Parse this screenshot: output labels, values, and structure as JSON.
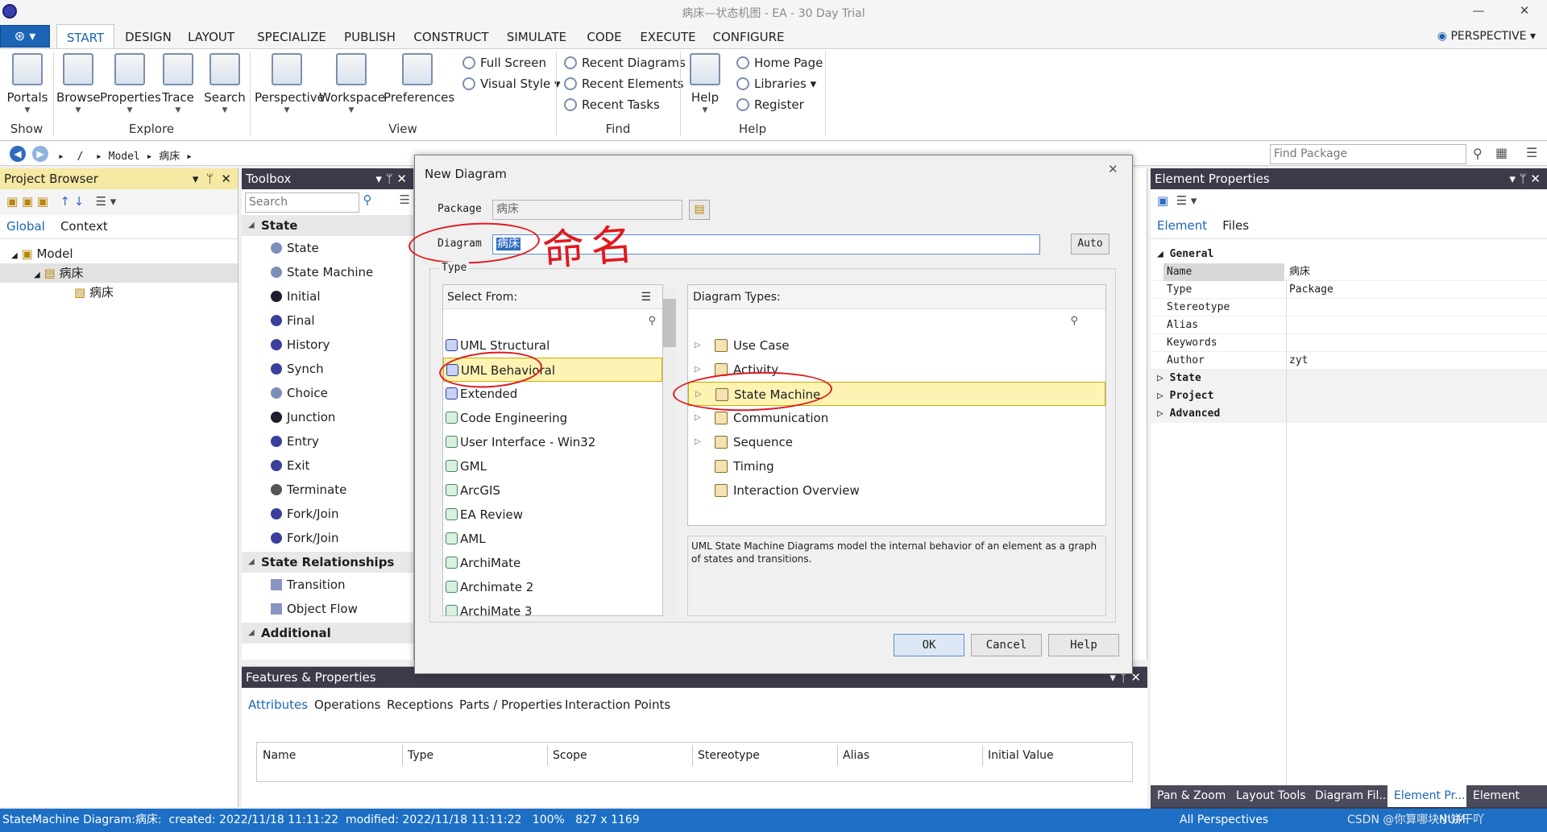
{
  "window": {
    "title": "病床—状态机图 - EA - 30 Day Trial"
  },
  "menu": {
    "tabs": [
      "START",
      "DESIGN",
      "LAYOUT",
      "SPECIALIZE",
      "PUBLISH",
      "CONSTRUCT",
      "SIMULATE",
      "CODE",
      "EXECUTE",
      "CONFIGURE"
    ],
    "perspective": "PERSPECTIVE"
  },
  "ribbon": {
    "portals": "Portals",
    "show": "Show",
    "browse": "Browse",
    "properties": "Properties",
    "trace": "Trace",
    "search": "Search",
    "explore": "Explore",
    "perspective": "Perspective",
    "workspace": "Workspace",
    "preferences": "Preferences",
    "full_screen": "Full Screen",
    "visual_style": "Visual Style",
    "view": "View",
    "recent_diagrams": "Recent Diagrams",
    "recent_elements": "Recent Elements",
    "recent_tasks": "Recent Tasks",
    "find": "Find",
    "help": "Help",
    "home_page": "Home Page",
    "libraries": "Libraries",
    "register": "Register",
    "help_group": "Help"
  },
  "address": {
    "root": "/",
    "model": "Model",
    "item": "病床",
    "find_package": "Find Package"
  },
  "project_browser": {
    "title": "Project Browser",
    "tab_global": "Global",
    "tab_context": "Context",
    "model": "Model",
    "package": "病床",
    "diagram": "病床"
  },
  "toolbox": {
    "title": "Toolbox",
    "search": "Search",
    "section_state": "State",
    "items": [
      "State",
      "State Machine",
      "Initial",
      "Final",
      "History",
      "Synch",
      "Choice",
      "Junction",
      "Entry",
      "Exit",
      "Terminate",
      "Fork/Join",
      "Fork/Join"
    ],
    "section_rel": "State Relationships",
    "rel_items": [
      "Transition",
      "Object Flow"
    ],
    "section_additional": "Additional"
  },
  "dialog": {
    "title": "New Diagram",
    "package_label": "Package",
    "package_value": "病床",
    "diagram_label": "Diagram",
    "diagram_value": "病床",
    "auto": "Auto",
    "type_label": "Type",
    "select_from": "Select From:",
    "diagram_types": "Diagram Types:",
    "select_items": [
      "UML Structural",
      "UML Behavioral",
      "Extended",
      "Code Engineering",
      "User Interface - Win32",
      "GML",
      "ArcGIS",
      "EA Review",
      "AML",
      "ArchiMate",
      "Archimate 2",
      "ArchiMate 3"
    ],
    "type_items": [
      "Use Case",
      "Activity",
      "State Machine",
      "Communication",
      "Sequence",
      "Timing",
      "Interaction Overview"
    ],
    "description": "UML State Machine Diagrams model the internal behavior of an element as a graph of states and transitions.",
    "ok": "OK",
    "cancel": "Cancel",
    "help": "Help",
    "annotation": "命名"
  },
  "features": {
    "title": "Features & Properties",
    "tabs": [
      "Attributes",
      "Operations",
      "Receptions",
      "Parts / Properties",
      "Interaction Points"
    ],
    "columns": [
      "Name",
      "Type",
      "Scope",
      "Stereotype",
      "Alias",
      "Initial Value"
    ]
  },
  "element_properties": {
    "title": "Element Properties",
    "tab_element": "Element",
    "tab_files": "Files",
    "general": "General",
    "rows": [
      {
        "k": "Name",
        "v": "病床"
      },
      {
        "k": "Type",
        "v": "Package"
      },
      {
        "k": "Stereotype",
        "v": ""
      },
      {
        "k": "Alias",
        "v": ""
      },
      {
        "k": "Keywords",
        "v": ""
      },
      {
        "k": "Author",
        "v": "zyt"
      }
    ],
    "sections": [
      "State",
      "Project",
      "Advanced"
    ]
  },
  "bottom_tabs": [
    "Pan & Zoom",
    "Layout Tools",
    "Diagram Fil...",
    "Element Pr...",
    "Element No..."
  ],
  "status": {
    "text": "StateMachine Diagram:病床:  created: 2022/11/18 11:11:22  modified: 2022/11/18 11:11:22   100%   827 x 1169",
    "perspectives": "All Perspectives",
    "num": "NUM",
    "watermark": "CSDN @你算哪块小饼干吖"
  }
}
